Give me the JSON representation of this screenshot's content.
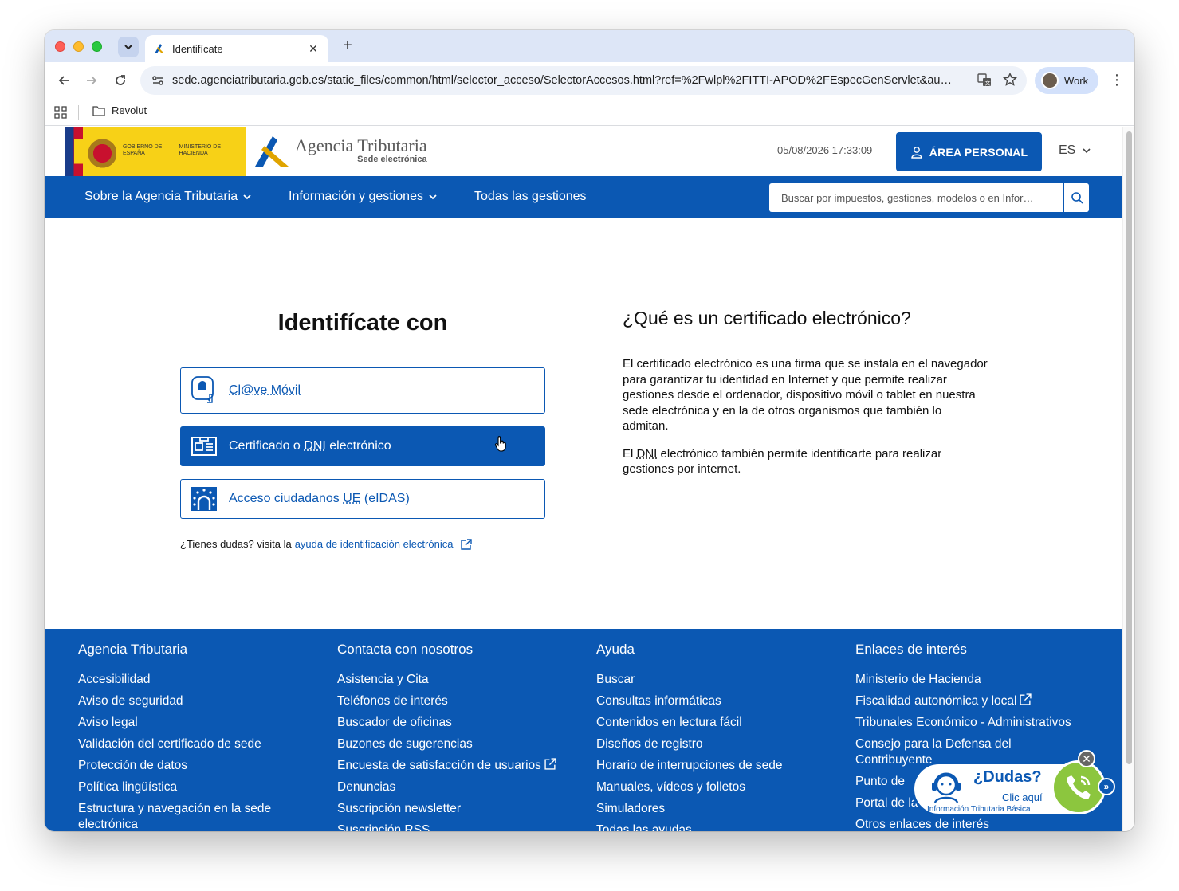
{
  "browser": {
    "tab_title": "Identifícate",
    "url": "sede.agenciatributaria.gob.es/static_files/common/html/selector_acceso/SelectorAccesos.html?ref=%2Fwlpl%2FITTI-APOD%2FEspecGenServlet&au…",
    "profile_name": "Work",
    "bookmarks": [
      {
        "label": "Revolut"
      }
    ]
  },
  "header": {
    "gov_text": "GOBIERNO DE ESPAÑA",
    "ministry_text": "MINISTERIO DE HACIENDA",
    "agency_name": "Agencia Tributaria",
    "agency_subtitle": "Sede electrónica",
    "datetime": "05/08/2026 17:33:09",
    "area_personal": "ÁREA PERSONAL",
    "language": "ES"
  },
  "nav": {
    "items": [
      {
        "label": "Sobre la Agencia Tributaria"
      },
      {
        "label": "Información y gestiones"
      },
      {
        "label": "Todas las gestiones"
      }
    ],
    "search_placeholder": "Buscar por impuestos, gestiones, modelos o en Infor…"
  },
  "login": {
    "title": "Identifícate con",
    "options": [
      {
        "label": "Cl@ve Móvil",
        "icon": "clave-movil-icon",
        "selected": false
      },
      {
        "label_pre": "Certificado o ",
        "label_abbr": "DNI",
        "label_post": " electrónico",
        "icon": "id-card-icon",
        "selected": true
      },
      {
        "label_pre": "Acceso ciudadanos ",
        "label_abbr": "UE",
        "label_post": " (eIDAS)",
        "icon": "eu-stars-icon",
        "selected": false
      }
    ],
    "help_text": "¿Tienes dudas? visita la",
    "help_link": "ayuda de identificación electrónica"
  },
  "info": {
    "title": "¿Qué es un certificado electrónico?",
    "p1": "El certificado electrónico es una firma que se instala en el navegador para garantizar tu identidad en Internet y que permite realizar gestiones desde el ordenador, dispositivo móvil o tablet en nuestra sede electrónica y en la de otros organismos que también lo admitan.",
    "p2_pre": "El ",
    "p2_abbr": "DNI",
    "p2_post": " electrónico también permite identificarte para realizar gestiones por internet."
  },
  "footer": {
    "columns": [
      {
        "heading": "Agencia Tributaria",
        "links": [
          "Accesibilidad",
          "Aviso de seguridad",
          "Aviso legal",
          "Validación del certificado de sede",
          "Protección de datos",
          "Política lingüística",
          "Estructura y navegación en la sede electrónica"
        ]
      },
      {
        "heading": "Contacta con nosotros",
        "links": [
          "Asistencia y Cita",
          "Teléfonos de interés",
          "Buscador de oficinas",
          "Buzones de sugerencias",
          "Encuesta de satisfacción de usuarios",
          "Denuncias",
          "Suscripción newsletter",
          "Suscripción RSS"
        ]
      },
      {
        "heading": "Ayuda",
        "links": [
          "Buscar",
          "Consultas informáticas",
          "Contenidos en lectura fácil",
          "Diseños de registro",
          "Horario de interrupciones de sede",
          "Manuales, vídeos y folletos",
          "Simuladores",
          "Todas las ayudas"
        ]
      },
      {
        "heading": "Enlaces de interés",
        "links": [
          "Ministerio de Hacienda",
          "Fiscalidad autonómica y local",
          "Tribunales Económico - Administrativos",
          "Consejo para la Defensa del Contribuyente",
          "Punto de",
          "Portal de la",
          "Otros enlaces de interés"
        ]
      }
    ]
  },
  "dudas": {
    "title": "¿Dudas?",
    "cta": "Clic aquí",
    "subtitle": "Información Tributaria Básica"
  },
  "colors": {
    "brand_blue": "#0b58b3",
    "phone_green": "#8cc63e",
    "gov_yellow": "#f7d117"
  }
}
